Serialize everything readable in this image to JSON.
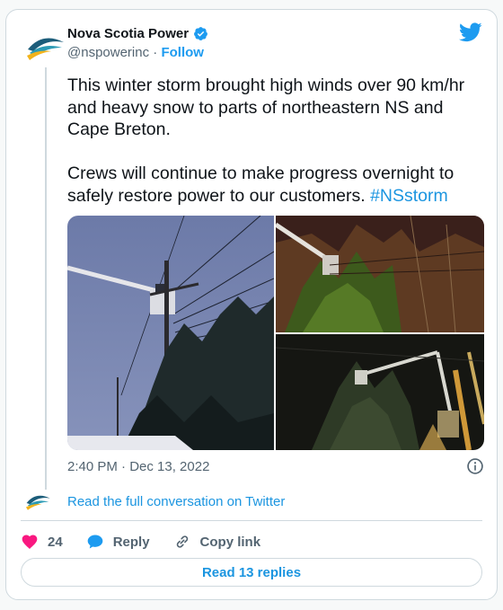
{
  "author": {
    "name": "Nova Scotia Power",
    "handle": "@nspowerinc",
    "separator": "·",
    "follow_label": "Follow",
    "verified": true
  },
  "tweet": {
    "text_part1": "This winter storm brought high winds over 90 km/hr and heavy snow to parts of northeastern NS and Cape Breton.\n\nCrews will continue to make progress overnight to safely restore power to our customers. ",
    "hashtag": "#NSstorm",
    "timestamp": "2:40 PM · Dec 13, 2022"
  },
  "media": {
    "images": [
      "bucket-truck-dusk-photo",
      "bucket-truck-night-photo-1",
      "bucket-truck-night-photo-2"
    ]
  },
  "conversation_link": "Read the full conversation on Twitter",
  "actions": {
    "like_count": "24",
    "reply_label": "Reply",
    "copy_link_label": "Copy link"
  },
  "read_replies_label": "Read 13 replies",
  "colors": {
    "link": "#1b95e0",
    "like": "#f91880",
    "secondary_text": "#536471",
    "border": "#cfd9de"
  }
}
